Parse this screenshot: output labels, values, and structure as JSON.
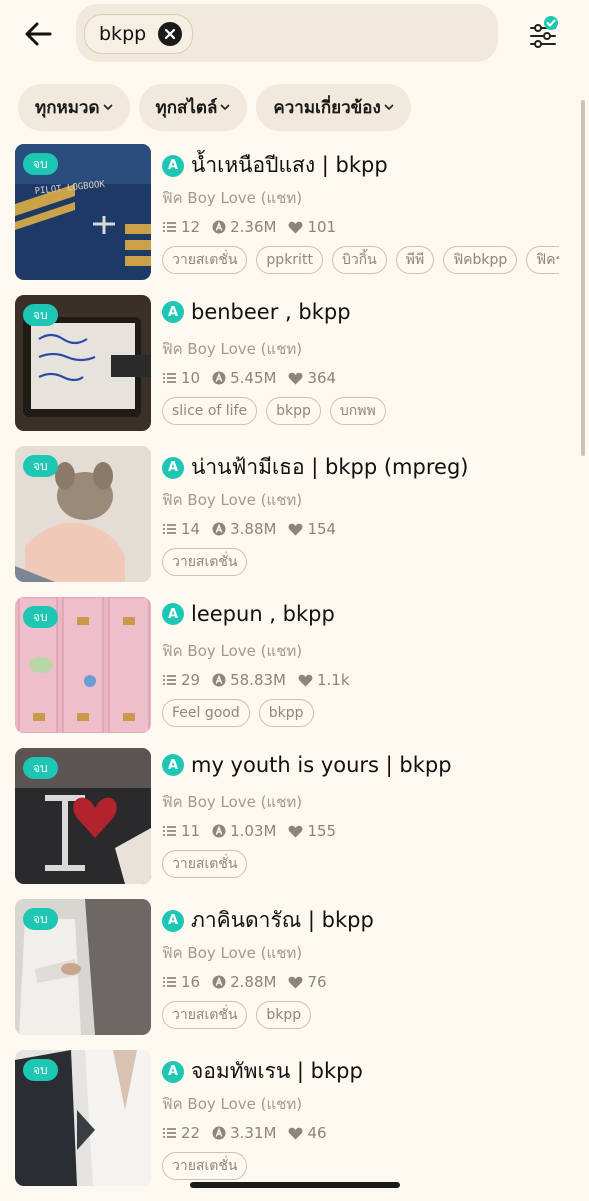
{
  "search": {
    "query": "bkpp"
  },
  "filters": [
    {
      "label": "ทุกหมวด"
    },
    {
      "label": "ทุกสไตล์"
    },
    {
      "label": "ความเกี่ยวข้อง"
    }
  ],
  "colors": {
    "accent": "#1ec7b4",
    "background": "#fdf8f0",
    "pill": "#f1e9db"
  },
  "results": [
    {
      "badge": "จบ",
      "title": "น้ำเหนือปีแสง | bkpp",
      "category": "ฟิค Boy Love (แชท)",
      "chapters": "12",
      "views": "2.36M",
      "likes": "101",
      "tags": [
        "วายสเตชั่น",
        "ppkritt",
        "บิวกิ้น",
        "พีพี",
        "ฟิคbkpp",
        "ฟิคร"
      ]
    },
    {
      "badge": "จบ",
      "title": "benbeer , bkpp",
      "category": "ฟิค Boy Love (แชท)",
      "chapters": "10",
      "views": "5.45M",
      "likes": "364",
      "tags": [
        "slice of life",
        "bkpp",
        "บกพพ"
      ]
    },
    {
      "badge": "จบ",
      "title": "น่านฟ้ามีเธอ | bkpp (mpreg)",
      "category": "ฟิค Boy Love (แชท)",
      "chapters": "14",
      "views": "3.88M",
      "likes": "154",
      "tags": [
        "วายสเตชั่น"
      ]
    },
    {
      "badge": "จบ",
      "title": "leepun , bkpp",
      "category": "ฟิค Boy Love (แชท)",
      "chapters": "29",
      "views": "58.83M",
      "likes": "1.1k",
      "tags": [
        "Feel good",
        "bkpp"
      ]
    },
    {
      "badge": "จบ",
      "title": "my youth is yours | bkpp",
      "category": "ฟิค Boy Love (แชท)",
      "chapters": "11",
      "views": "1.03M",
      "likes": "155",
      "tags": [
        "วายสเตชั่น"
      ]
    },
    {
      "badge": "จบ",
      "title": "ภาคินดารัณ | bkpp",
      "category": "ฟิค Boy Love (แชท)",
      "chapters": "16",
      "views": "2.88M",
      "likes": "76",
      "tags": [
        "วายสเตชั่น",
        "bkpp"
      ]
    },
    {
      "badge": "จบ",
      "title": "จอมทัพเรน | bkpp",
      "category": "ฟิค Boy Love (แชท)",
      "chapters": "22",
      "views": "3.31M",
      "likes": "46",
      "tags": [
        "วายสเตชั่น"
      ]
    }
  ]
}
